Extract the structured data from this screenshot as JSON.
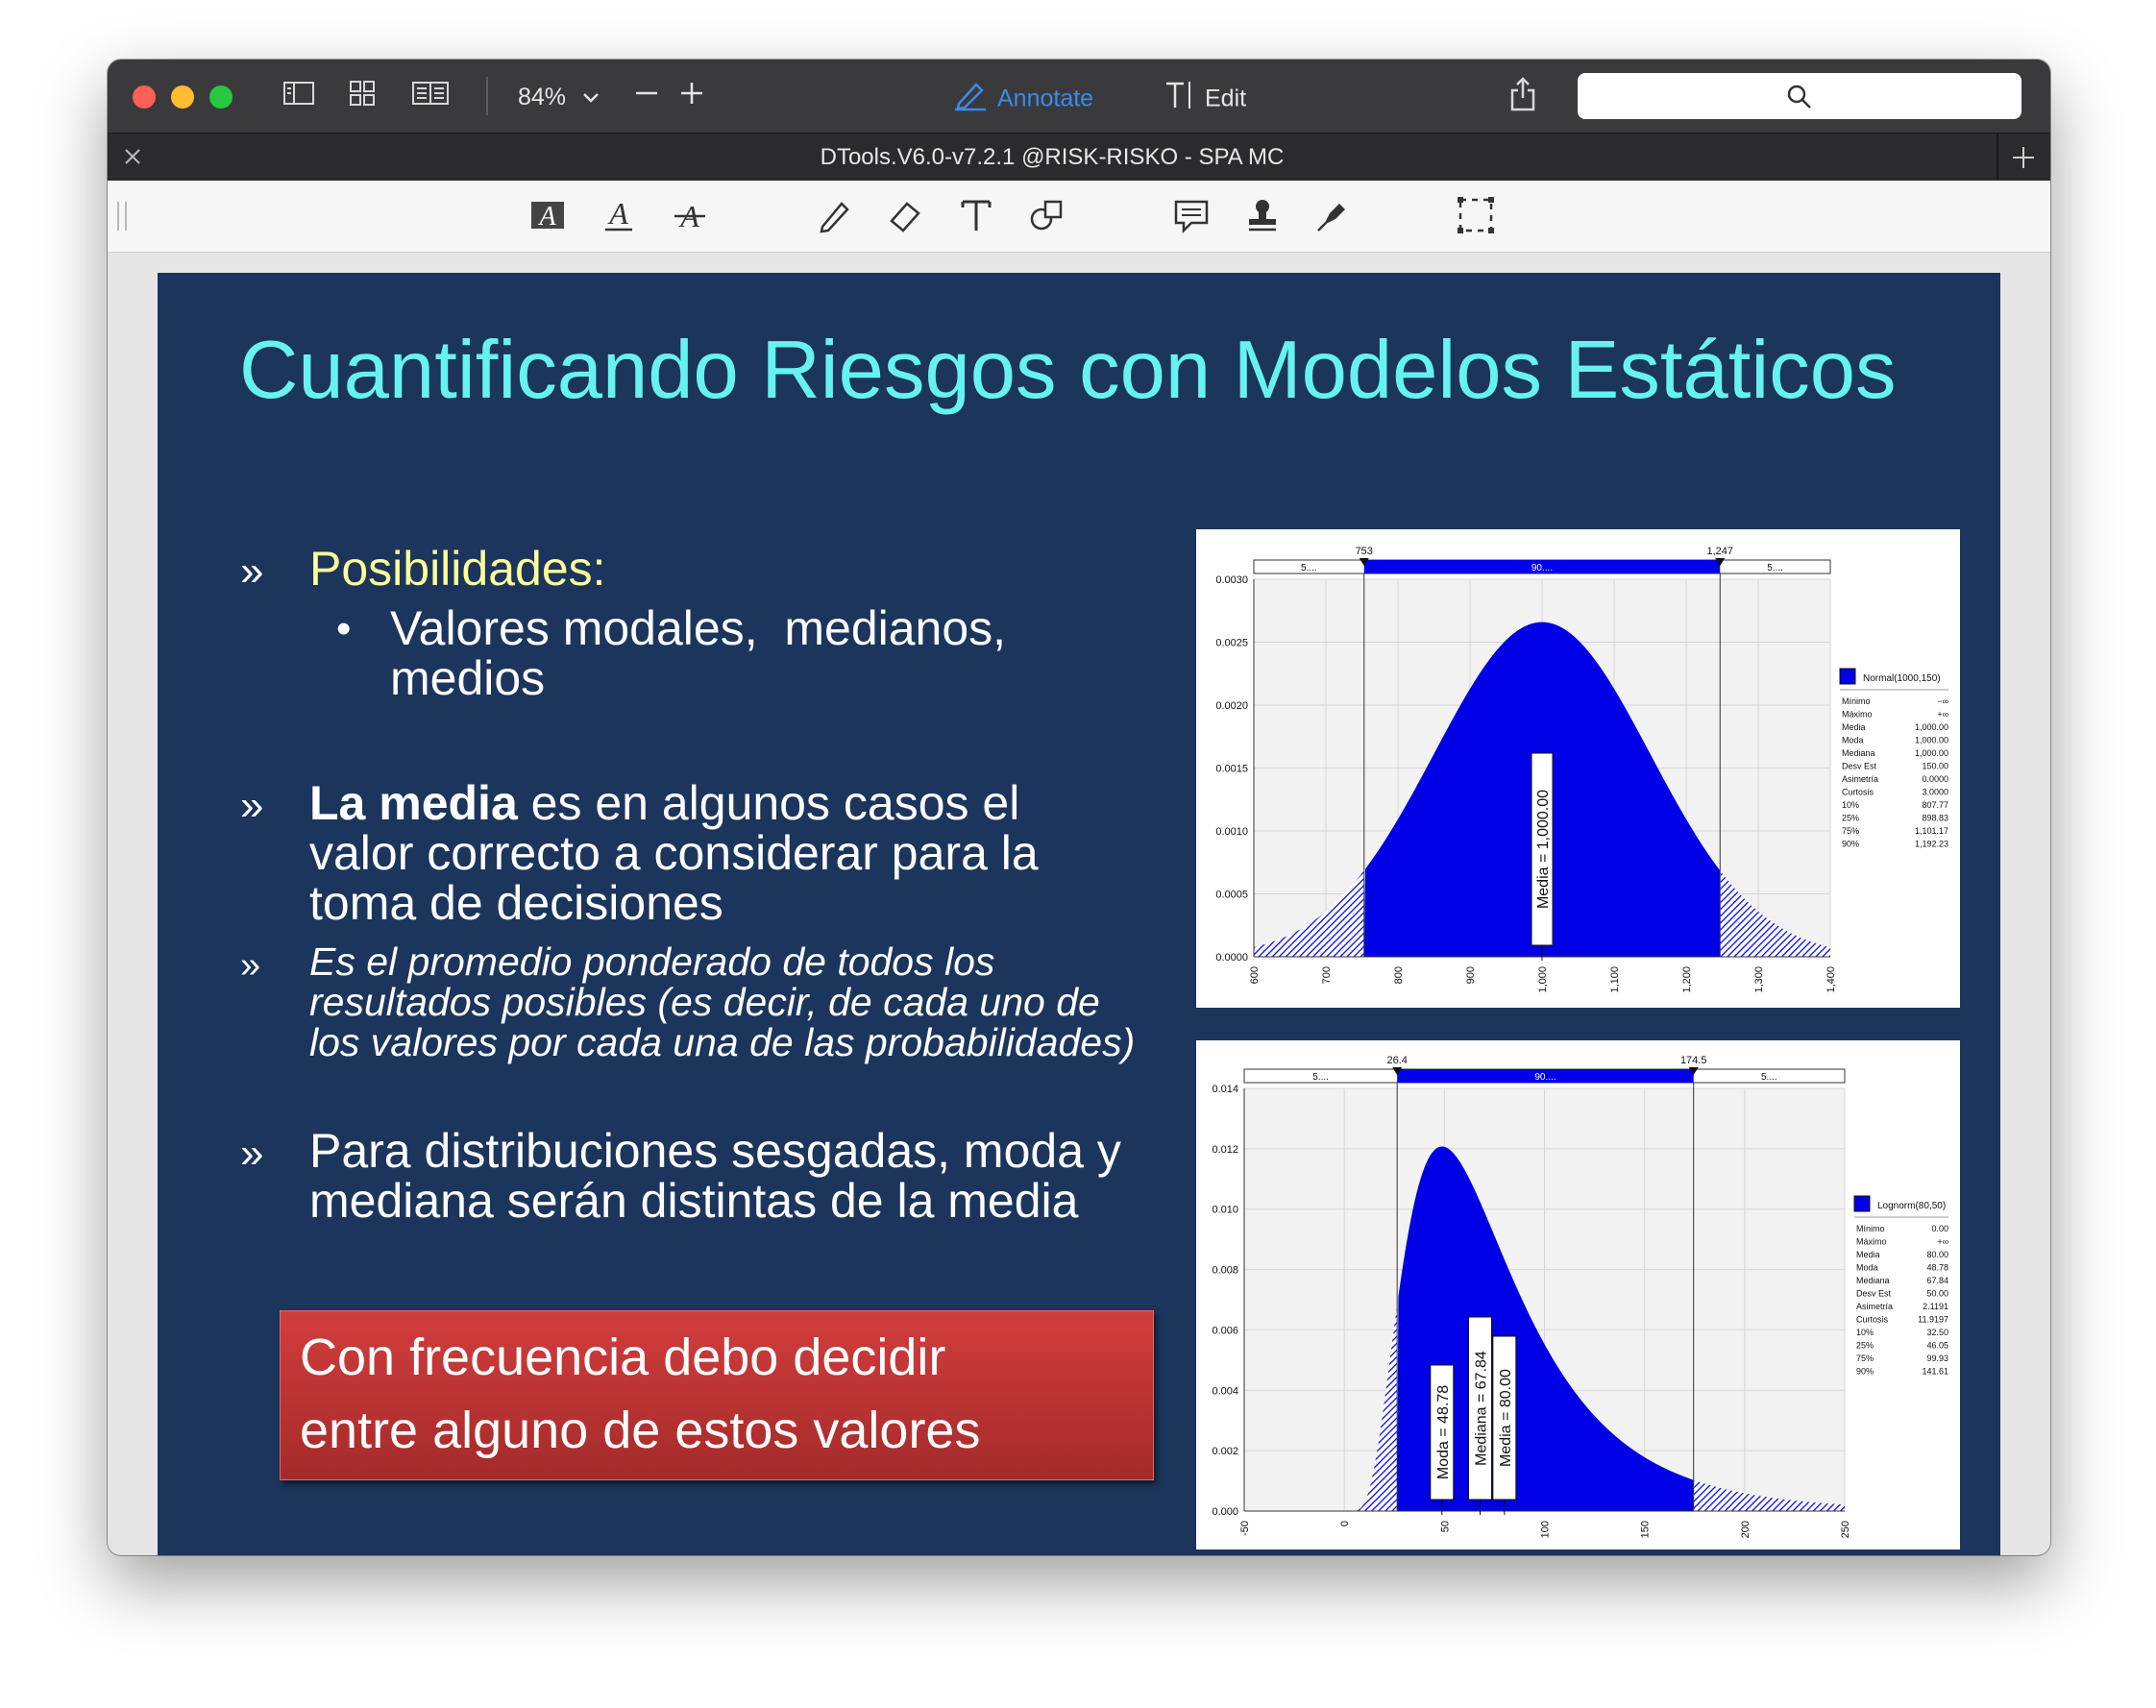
{
  "app": {
    "zoom": "84%",
    "annotate_label": "Annotate",
    "edit_label": "Edit",
    "document_title": "DTools.V6.0-v7.2.1 @RISK-RISKO - SPA MC",
    "colors": {
      "accent": "#3d8ae6",
      "slide_bg": "#1c355d",
      "title": "#66f2f2",
      "subtitle": "#ffff99",
      "callout": "#c0392b",
      "curve": "#0000e6"
    }
  },
  "slide": {
    "title": "Cuantificando Riesgos con Modelos Estáticos",
    "bullet_marker": "»",
    "sub_marker": "•",
    "b1_head": "Posibilidades:",
    "b1_sub_line1": "Valores modales,  medianos,",
    "b1_sub_line2": "medios",
    "b2_bold": "La media",
    "b2_line1_rest": " es en algunos casos el",
    "b2_line2": "valor correcto a considerar para la",
    "b2_line3": "toma de decisiones",
    "b3_line1": "Es el promedio ponderado de todos los",
    "b3_line2": "resultados posibles (es decir, de cada uno de",
    "b3_line3": "los valores por cada una de las probabilidades)",
    "b4_line1": "Para distribuciones sesgadas, moda y",
    "b4_line2": "mediana serán distintas de la media",
    "callout_line1": "Con frecuencia debo decidir",
    "callout_line2": "entre alguno de estos valores"
  },
  "chart_data": [
    {
      "type": "area",
      "distribution": "Normal(1000,150)",
      "x_ticks": [
        "600",
        "700",
        "800",
        "900",
        "1,000",
        "1,100",
        "1,200",
        "1,300",
        "1,400"
      ],
      "y_ticks": [
        "0.0000",
        "0.0005",
        "0.0010",
        "0.0015",
        "0.0020",
        "0.0025",
        "0.0030"
      ],
      "xlim": [
        600,
        1400
      ],
      "ylim": [
        0,
        0.003
      ],
      "delimiters": {
        "left": "753",
        "right": "1,247",
        "left_pct": "5....",
        "mid_pct": "90....",
        "right_pct": "5...."
      },
      "marker_labels": [
        "Media = 1,000.00"
      ],
      "legend": {
        "title": "Normal(1000,150)",
        "placement": "right",
        "rows": [
          [
            "Mínimo",
            "−∞"
          ],
          [
            "Máximo",
            "+∞"
          ],
          [
            "Media",
            "1,000.00"
          ],
          [
            "Moda",
            "1,000.00"
          ],
          [
            "Mediana",
            "1,000.00"
          ],
          [
            "Desv Est",
            "150.00"
          ],
          [
            "Asimetría",
            "0.0000"
          ],
          [
            "Curtosis",
            "3.0000"
          ],
          [
            "10%",
            "807.77"
          ],
          [
            "25%",
            "898.83"
          ],
          [
            "75%",
            "1,101.17"
          ],
          [
            "90%",
            "1,192.23"
          ]
        ]
      }
    },
    {
      "type": "area",
      "distribution": "Lognorm(80,50)",
      "x_ticks": [
        "-50",
        "0",
        "50",
        "100",
        "150",
        "200",
        "250"
      ],
      "y_ticks": [
        "0.000",
        "0.002",
        "0.004",
        "0.006",
        "0.008",
        "0.010",
        "0.012",
        "0.014"
      ],
      "xlim": [
        -50,
        250
      ],
      "ylim": [
        0,
        0.014
      ],
      "delimiters": {
        "left": "26.4",
        "right": "174.5",
        "left_pct": "5....",
        "mid_pct": "90....",
        "right_pct": "5...."
      },
      "marker_labels": [
        "Moda = 48.78",
        "Mediana = 67.84",
        "Media = 80.00"
      ],
      "legend": {
        "title": "Lognorm(80,50)",
        "placement": "right",
        "rows": [
          [
            "Mínimo",
            "0.00"
          ],
          [
            "Máximo",
            "+∞"
          ],
          [
            "Media",
            "80.00"
          ],
          [
            "Moda",
            "48.78"
          ],
          [
            "Mediana",
            "67.84"
          ],
          [
            "Desv Est",
            "50.00"
          ],
          [
            "Asimetría",
            "2.1191"
          ],
          [
            "Curtosis",
            "11.9197"
          ],
          [
            "10%",
            "32.50"
          ],
          [
            "25%",
            "46.05"
          ],
          [
            "75%",
            "99.93"
          ],
          [
            "90%",
            "141.61"
          ]
        ]
      }
    }
  ]
}
